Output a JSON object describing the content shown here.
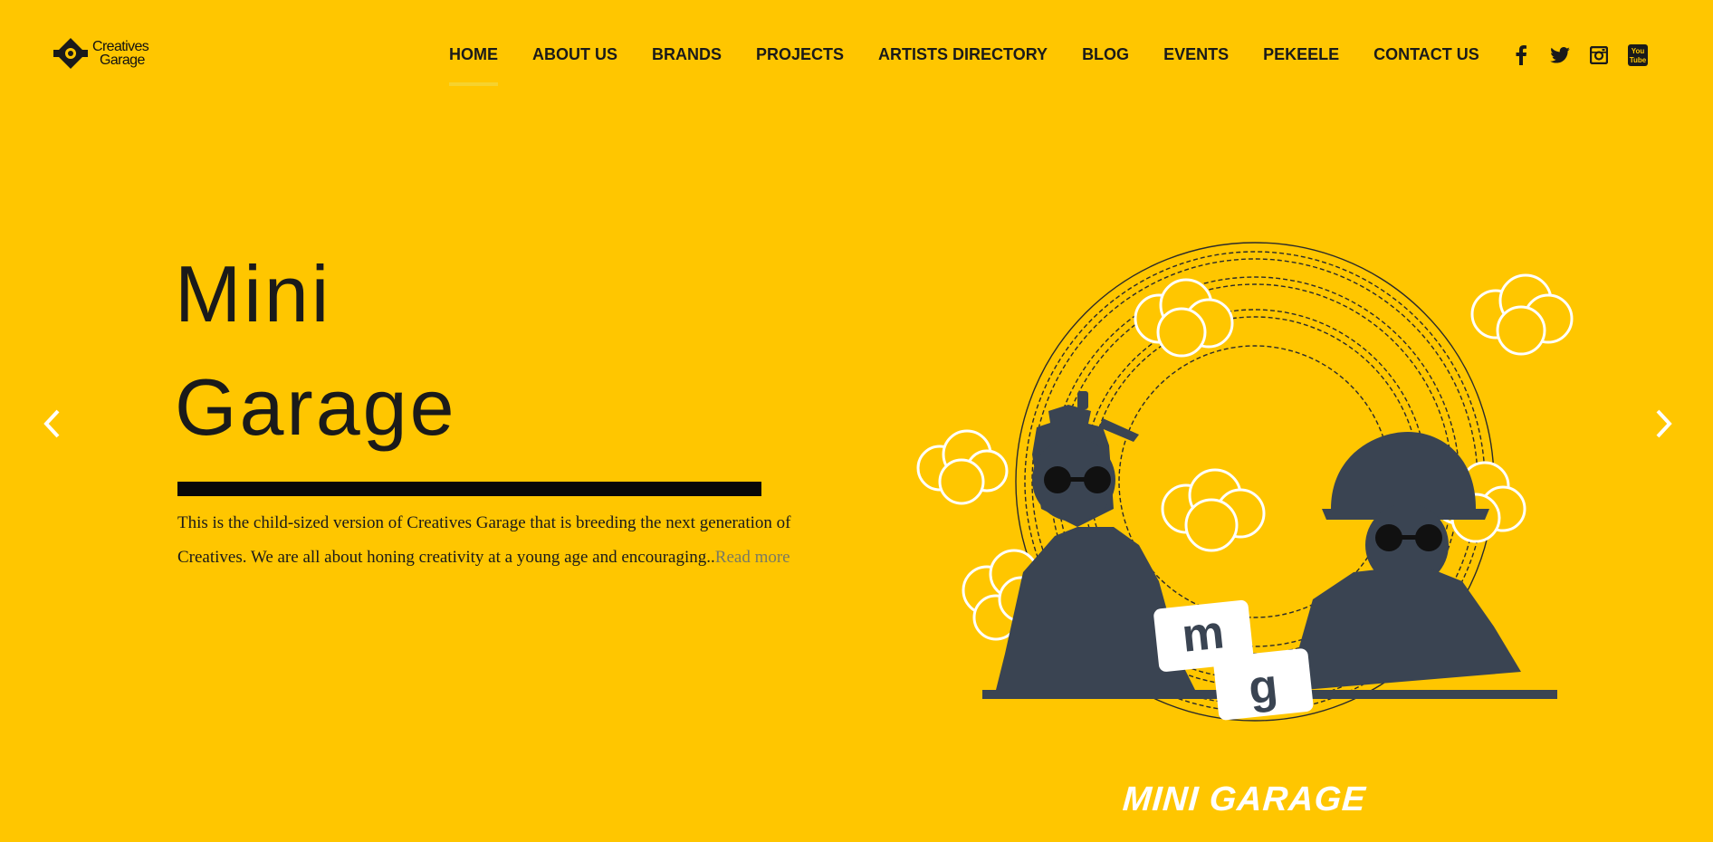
{
  "brand": {
    "name_line1": "Creatives",
    "name_line2": "Garage"
  },
  "nav": {
    "items": [
      {
        "label": "HOME",
        "active": true
      },
      {
        "label": "ABOUT US",
        "active": false
      },
      {
        "label": "BRANDS",
        "active": false
      },
      {
        "label": "PROJECTS",
        "active": false
      },
      {
        "label": "ARTISTS DIRECTORY",
        "active": false
      },
      {
        "label": "BLOG",
        "active": false
      },
      {
        "label": "EVENTS",
        "active": false
      },
      {
        "label": "PEKEELE",
        "active": false
      },
      {
        "label": "CONTACT US",
        "active": false
      }
    ]
  },
  "social": {
    "icons": [
      "facebook-icon",
      "twitter-icon",
      "instagram-icon",
      "youtube-icon"
    ]
  },
  "hero": {
    "title_line1": "Mini",
    "title_line2": "Garage",
    "description": "This is the child-sized version of Creatives Garage that is breeding the next generation of Creatives. We are all about honing creativity at a young age and encouraging..",
    "read_more": "Read more",
    "artwork_caption": "MINI GARAGE",
    "artwork_badge": "mg"
  },
  "colors": {
    "background": "#FFC600",
    "text": "#1a1a1a",
    "active_underline": "#F6D22E",
    "read_more": "#7a7a62",
    "figure": "#3a4452"
  }
}
